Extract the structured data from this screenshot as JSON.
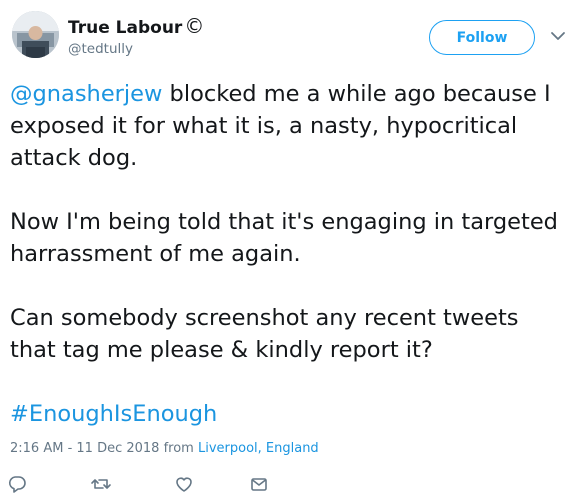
{
  "user": {
    "display_name": "True Labour",
    "copyright_symbol": "©",
    "handle": "@tedtully"
  },
  "follow_button": {
    "label": "Follow"
  },
  "tweet": {
    "mention": "@gnasherjew",
    "line1_rest": " blocked me a while ago because I exposed it for what it is, a nasty, hypocritical attack dog.",
    "paragraph2": "Now I'm being told that it's engaging in targeted harrassment of me again.",
    "paragraph3": "Can somebody screenshot any recent tweets that tag me please & kindly report it?",
    "hashtag": "#EnoughIsEnough"
  },
  "meta": {
    "time": "2:16 AM - 11 Dec 2018",
    "from_label": "from",
    "location": "Liverpool, England"
  },
  "colors": {
    "accent": "#1da1f2",
    "link": "#1b95e0",
    "secondary_text": "#657786"
  },
  "icons": [
    "chevron-down-icon",
    "reply-icon",
    "retweet-icon",
    "like-icon",
    "direct-message-icon"
  ]
}
